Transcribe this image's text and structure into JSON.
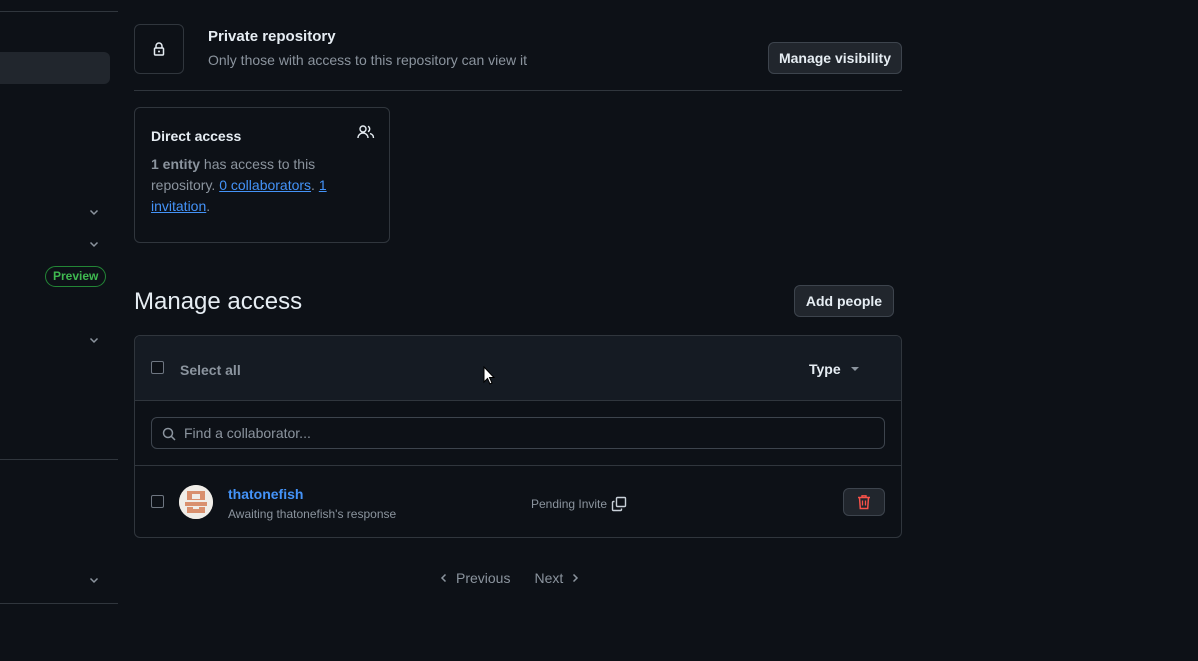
{
  "sidebar": {
    "badge": "Preview"
  },
  "visibility": {
    "title": "Private repository",
    "description": "Only those with access to this repository can view it",
    "button": "Manage visibility",
    "icon": "lock-icon"
  },
  "direct_access": {
    "title": "Direct access",
    "icon": "people-icon",
    "entity_count": "1 entity",
    "text_mid": " has access to this repository. ",
    "collaborators_link": "0 collaborators",
    "sep": ". ",
    "invitation_link": "1 invitation",
    "text_end": "."
  },
  "manage_access": {
    "title": "Manage access",
    "add_button": "Add people",
    "select_all": "Select all",
    "type_filter": "Type",
    "search_placeholder": "Find a collaborator...",
    "members": [
      {
        "name": "thatonefish",
        "subtitle": "Awaiting thatonefish's response",
        "status": "Pending Invite"
      }
    ]
  },
  "pagination": {
    "previous": "Previous",
    "next": "Next"
  },
  "colors": {
    "background": "#0d1117",
    "link": "#4493f8",
    "danger": "#f85149",
    "success": "#3fb950"
  }
}
